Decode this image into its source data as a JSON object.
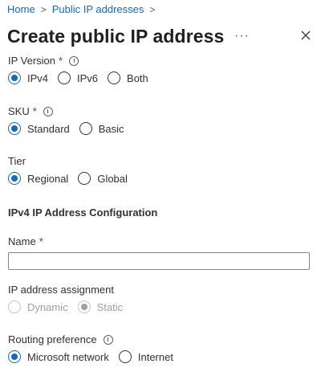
{
  "breadcrumb": {
    "items": [
      "Home",
      "Public IP addresses"
    ],
    "separator": ">"
  },
  "header": {
    "title": "Create public IP address",
    "more_label": "···"
  },
  "ip_version": {
    "label": "IP Version",
    "required_mark": "*",
    "options": [
      "IPv4",
      "IPv6",
      "Both"
    ],
    "selected": "IPv4"
  },
  "sku": {
    "label": "SKU",
    "required_mark": "*",
    "options": [
      "Standard",
      "Basic"
    ],
    "selected": "Standard"
  },
  "tier": {
    "label": "Tier",
    "options": [
      "Regional",
      "Global"
    ],
    "selected": "Regional"
  },
  "section": {
    "title": "IPv4 IP Address Configuration"
  },
  "name": {
    "label": "Name",
    "required_mark": "*",
    "value": "",
    "placeholder": ""
  },
  "assignment": {
    "label": "IP address assignment",
    "options": [
      "Dynamic",
      "Static"
    ],
    "selected": "Static",
    "disabled": true
  },
  "routing": {
    "label": "Routing preference",
    "options": [
      "Microsoft network",
      "Internet"
    ],
    "selected": "Microsoft network"
  },
  "colors": {
    "accent": "#0f6cbd",
    "required": "#a4262c",
    "disabled": "#a19f9d"
  }
}
